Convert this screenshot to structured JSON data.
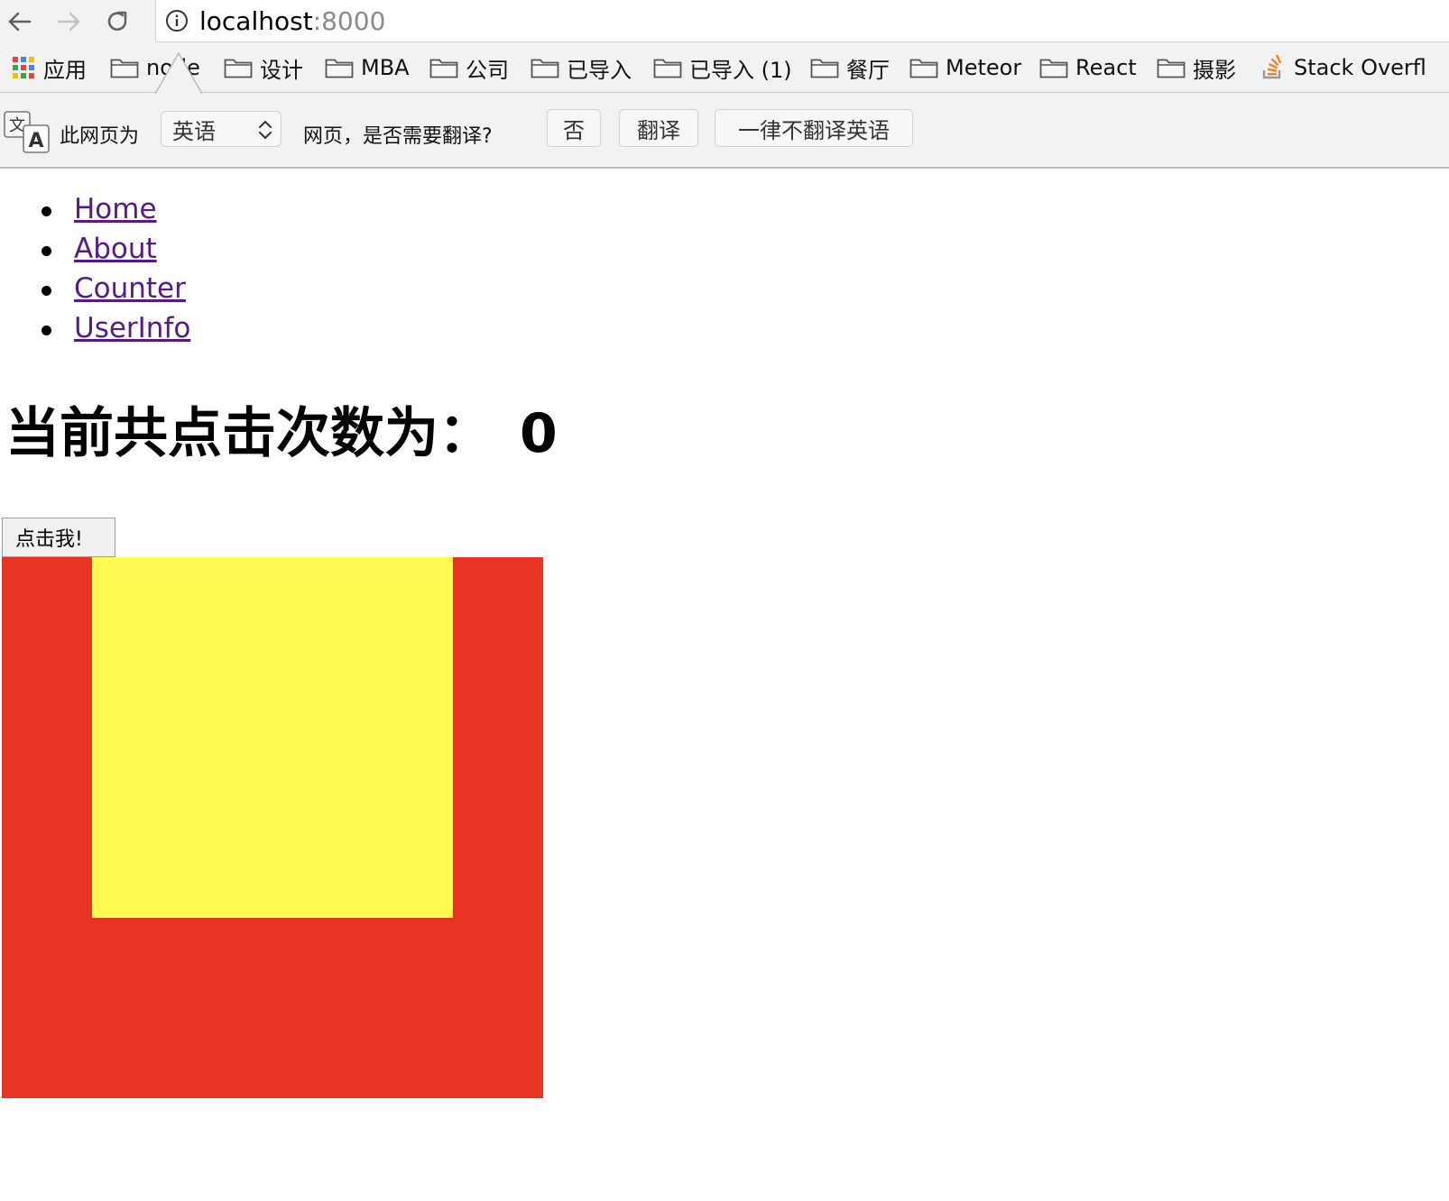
{
  "browser": {
    "url_host": "localhost",
    "url_port": ":8000"
  },
  "bookmarks": [
    {
      "label": "应用",
      "icon": "apps-grid-icon"
    },
    {
      "label": "node",
      "icon": "folder-icon"
    },
    {
      "label": "设计",
      "icon": "folder-icon"
    },
    {
      "label": "MBA",
      "icon": "folder-icon"
    },
    {
      "label": "公司",
      "icon": "folder-icon"
    },
    {
      "label": "已导入",
      "icon": "folder-icon"
    },
    {
      "label": "已导入 (1)",
      "icon": "folder-icon"
    },
    {
      "label": "餐厅",
      "icon": "folder-icon"
    },
    {
      "label": "Meteor",
      "icon": "folder-icon"
    },
    {
      "label": "React",
      "icon": "folder-icon"
    },
    {
      "label": "摄影",
      "icon": "folder-icon"
    },
    {
      "label": "Stack Overfl",
      "icon": "stackoverflow-icon"
    }
  ],
  "translate": {
    "prefix": "此网页为",
    "language": "英语",
    "question": "网页，是否需要翻译?",
    "no_label": "否",
    "translate_label": "翻译",
    "never_label": "一律不翻译英语"
  },
  "nav": {
    "links": [
      "Home",
      "About",
      "Counter",
      "UserInfo"
    ]
  },
  "counter": {
    "heading": "当前共点击次数为：",
    "count": "0",
    "button_label": "点击我!"
  },
  "colors": {
    "link": "#551a8b",
    "outer_box": "#e93323",
    "inner_box": "#fefb51"
  }
}
